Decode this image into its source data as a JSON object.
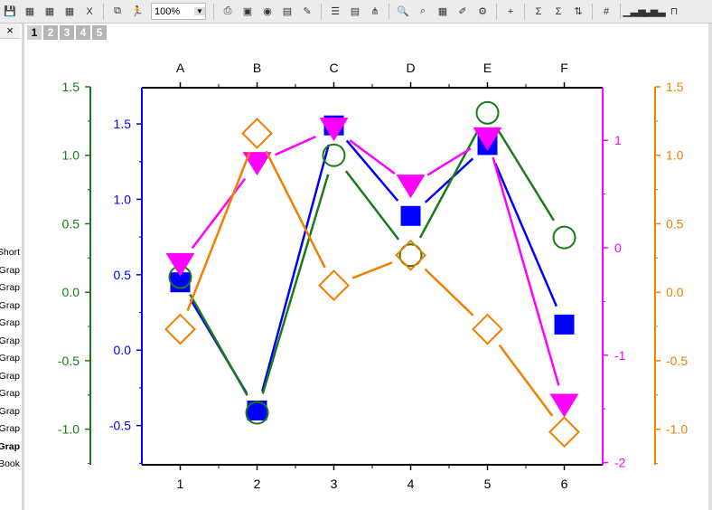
{
  "toolbar": {
    "zoom_value": "100%",
    "icons": [
      "save-icon",
      "import-wizard-icon",
      "import-ascii-icon",
      "import-multiple-ascii-icon",
      "import-excel-icon",
      "duplicate-icon",
      "runner-icon",
      "print-icon",
      "slide-show-icon",
      "paint-icon",
      "movie-icon",
      "edit-icon",
      "layers-icon",
      "compare-icon",
      "hierarchy-icon",
      "zoom-icon",
      "data-reader-icon",
      "worksheet-icon",
      "notes-icon",
      "settings-icon",
      "add-column-icon",
      "sum-column-icon",
      "sigma-icon",
      "sort-icon",
      "numbers-icon",
      "column-chart-icon",
      "grouped-column-icon",
      "step-chart-icon"
    ]
  },
  "left_panel": {
    "close_label": "×",
    "items": [
      "Short",
      "Grap",
      "Grap",
      "Grap",
      "Grap",
      "Grap",
      "Grap",
      "Grap",
      "Grap",
      "Grap",
      "Grap",
      "Grap",
      "Book"
    ],
    "bold_index": 11
  },
  "pages": [
    "1",
    "2",
    "3",
    "4",
    "5"
  ],
  "chart_data": {
    "type": "line",
    "x": [
      1,
      2,
      3,
      4,
      5,
      6
    ],
    "x_ticks": [
      "1",
      "2",
      "3",
      "4",
      "5",
      "6"
    ],
    "top_ticks": [
      "A",
      "B",
      "C",
      "D",
      "E",
      "F"
    ],
    "xlim": [
      0.5,
      6.5
    ],
    "axes": {
      "blue_left": {
        "color": "#0000ff",
        "ylim": [
          -0.76,
          1.74
        ],
        "ticks": [
          -0.5,
          0.0,
          0.5,
          1.0,
          1.5
        ],
        "labels": [
          "-0.5",
          "0.0",
          "0.5",
          "1.0",
          "1.5"
        ]
      },
      "green_left": {
        "color": "#1a7a1a",
        "ylim": [
          -1.26,
          1.5
        ],
        "ticks": [
          -1.0,
          -0.5,
          0.0,
          0.5,
          1.0,
          1.5
        ],
        "labels": [
          "-1.0",
          "-0.5",
          "0.0",
          "0.5",
          "1.0",
          "1.5"
        ]
      },
      "magenta_right": {
        "color": "#ff00ff",
        "ylim": [
          -2.02,
          1.49
        ],
        "ticks": [
          -2,
          -1,
          0,
          1
        ],
        "labels": [
          "-2",
          "-1",
          "0",
          "1"
        ]
      },
      "orange_right": {
        "color": "#f08000",
        "ylim": [
          -1.26,
          1.5
        ],
        "ticks": [
          -1.0,
          -0.5,
          0.0,
          0.5,
          1.0,
          1.5
        ],
        "labels": [
          "-1.0",
          "-0.5",
          "0.0",
          "0.5",
          "1.0",
          "1.5"
        ]
      }
    },
    "series": [
      {
        "name": "blue",
        "axis": "blue_left",
        "marker": "square",
        "color": "#0000ff",
        "values": [
          0.45,
          -0.4,
          1.49,
          0.89,
          1.36,
          0.17
        ]
      },
      {
        "name": "green",
        "axis": "green_left",
        "marker": "circle",
        "color": "#1a7a1a",
        "values": [
          0.11,
          -0.88,
          1.0,
          0.27,
          1.31,
          0.4
        ]
      },
      {
        "name": "magenta",
        "axis": "magenta_right",
        "marker": "triangle-down",
        "color": "#ff00ff",
        "values": [
          -0.15,
          0.79,
          1.11,
          0.58,
          1.02,
          -1.46
        ]
      },
      {
        "name": "orange",
        "axis": "orange_right",
        "marker": "diamond",
        "color": "#f08000",
        "values": [
          -0.27,
          1.16,
          0.05,
          0.27,
          -0.27,
          -1.02
        ]
      }
    ]
  }
}
